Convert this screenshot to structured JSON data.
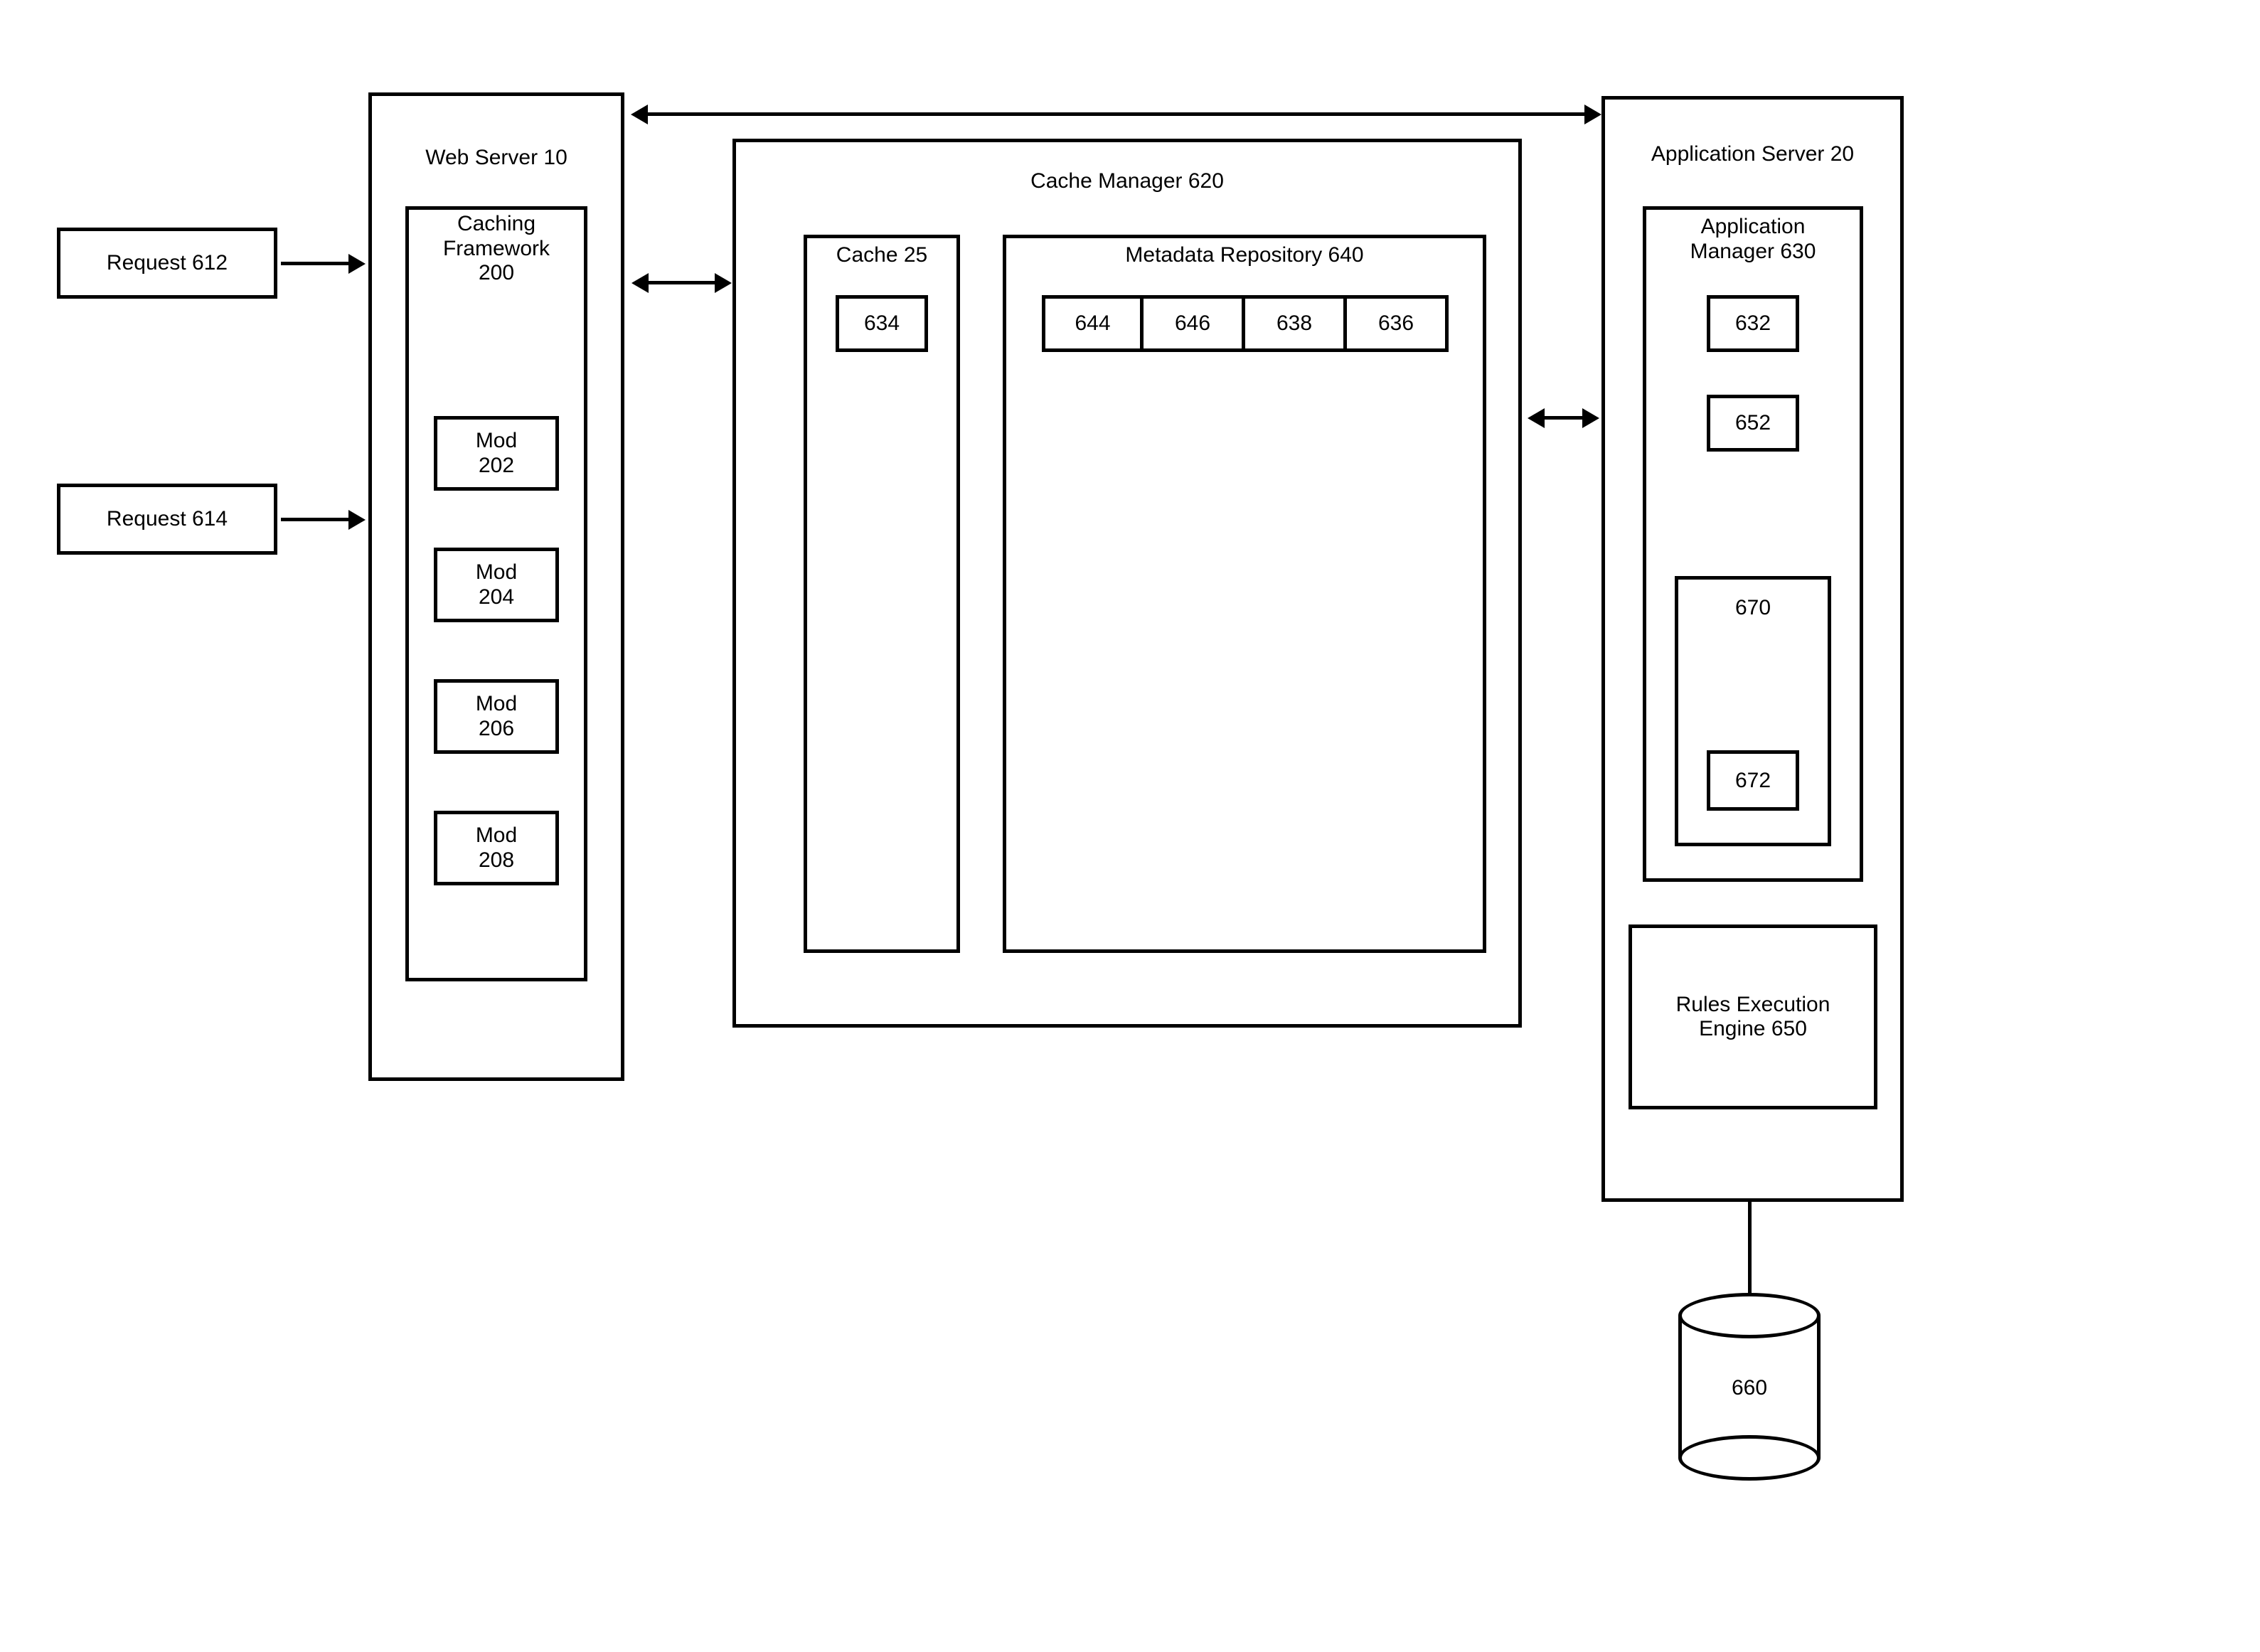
{
  "requests": {
    "r612": "Request 612",
    "r614": "Request 614"
  },
  "webServer": {
    "title": "Web Server 10",
    "cachingFramework": "Caching\nFramework\n200",
    "mods": {
      "m202": "Mod\n202",
      "m204": "Mod\n204",
      "m206": "Mod\n206",
      "m208": "Mod\n208"
    }
  },
  "cacheManager": {
    "title": "Cache Manager 620",
    "cache": {
      "title": "Cache 25",
      "item": "634"
    },
    "metadataRepo": {
      "title": "Metadata Repository 640",
      "cells": {
        "c1": "644",
        "c2": "646",
        "c3": "638",
        "c4": "636"
      }
    }
  },
  "appServer": {
    "title": "Application Server 20",
    "appManager": {
      "title": "Application\nManager 630",
      "b632": "632",
      "b652": "652",
      "b670": "670",
      "b672": "672"
    },
    "rulesEngine": "Rules Execution\nEngine 650"
  },
  "database": {
    "label": "660"
  }
}
